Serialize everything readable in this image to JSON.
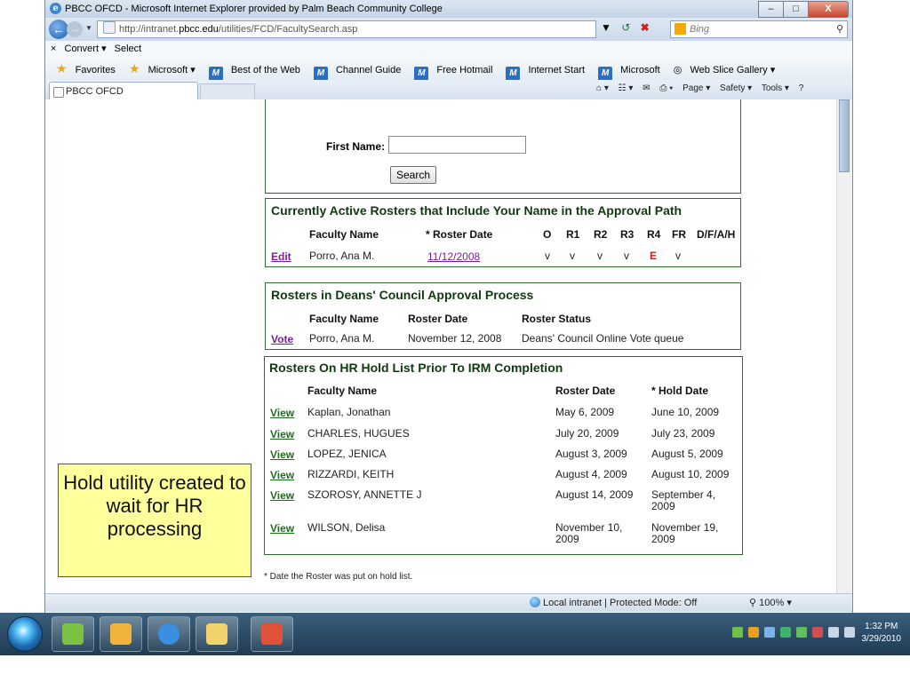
{
  "window": {
    "title": "PBCC OFCD - Microsoft Internet Explorer provided by Palm Beach Community College",
    "controls": {
      "minimize": "–",
      "maximize": "□",
      "close": "X"
    }
  },
  "address": {
    "url_prefix": "http://intranet.",
    "url_domain": "pbcc.edu",
    "url_path": "/utilities/FCD/FacultySearch.asp",
    "search_engine": "Bing"
  },
  "command_bar": {
    "convert": "Convert ▾",
    "select": "Select",
    "close_x": "×"
  },
  "favorites": {
    "label": "Favorites",
    "items": [
      "Microsoft ▾",
      "Best of the Web",
      "Channel Guide",
      "Free Hotmail",
      "Internet Start",
      "Microsoft",
      "Web Slice Gallery ▾"
    ]
  },
  "tab": {
    "title": "PBCC OFCD"
  },
  "right_tools": {
    "page": "Page ▾",
    "safety": "Safety ▾",
    "tools": "Tools ▾",
    "help": "?"
  },
  "search_form": {
    "first_name_label": "First Name:",
    "first_name_value": "",
    "search_button": "Search"
  },
  "active_rosters": {
    "heading": "Currently Active Rosters that Include Your Name in the Approval Path",
    "columns": [
      "Faculty Name",
      "* Roster Date",
      "O",
      "R1",
      "R2",
      "R3",
      "R4",
      "FR",
      "D/F/A/H"
    ],
    "row": {
      "action": "Edit",
      "faculty": "Porro, Ana M.",
      "date": "11/12/2008",
      "o": "v",
      "r1": "v",
      "r2": "v",
      "r3": "v",
      "r4": "E",
      "fr": "v"
    }
  },
  "deans_council": {
    "heading": "Rosters in Deans' Council Approval Process",
    "columns": [
      "Faculty Name",
      "Roster Date",
      "Roster Status"
    ],
    "row": {
      "action": "Vote",
      "faculty": "Porro, Ana M.",
      "date": "November 12, 2008",
      "status": "Deans' Council Online Vote queue"
    }
  },
  "hr_hold": {
    "heading": "Rosters On HR Hold List Prior To IRM Completion",
    "columns": [
      "Faculty Name",
      "Roster Date",
      "* Hold Date"
    ],
    "rows": [
      {
        "action": "View",
        "faculty": "Kaplan, Jonathan",
        "roster_date": "May 6, 2009",
        "hold_date": "June 10, 2009"
      },
      {
        "action": "View",
        "faculty": "CHARLES, HUGUES",
        "roster_date": "July 20, 2009",
        "hold_date": "July 23, 2009"
      },
      {
        "action": "View",
        "faculty": "LOPEZ, JENICA",
        "roster_date": "August 3, 2009",
        "hold_date": "August 5, 2009"
      },
      {
        "action": "View",
        "faculty": "RIZZARDI, KEITH",
        "roster_date": "August 4, 2009",
        "hold_date": "August 10, 2009"
      },
      {
        "action": "View",
        "faculty": "SZOROSY, ANNETTE J",
        "roster_date": "August 14, 2009",
        "hold_date": "September 4, 2009"
      },
      {
        "action": "View",
        "faculty": "WILSON, Delisa",
        "roster_date": "November 10, 2009",
        "hold_date": "November 19, 2009"
      }
    ],
    "footnote": "* Date the Roster was put on hold list."
  },
  "callout": {
    "text": "Hold utility created to wait for HR processing"
  },
  "status_bar": {
    "zone": "Local intranet | Protected Mode: Off",
    "zoom": "100%"
  },
  "taskbar": {
    "time": "1:32 PM",
    "date": "3/29/2010"
  },
  "colors": {
    "box_border": "#2e6b2e",
    "heading": "#103a10",
    "edit_link": "#7b1f9c",
    "view_link": "#1d6f1d",
    "callout_bg": "#ffff9c",
    "alert_red": "#e01818"
  }
}
